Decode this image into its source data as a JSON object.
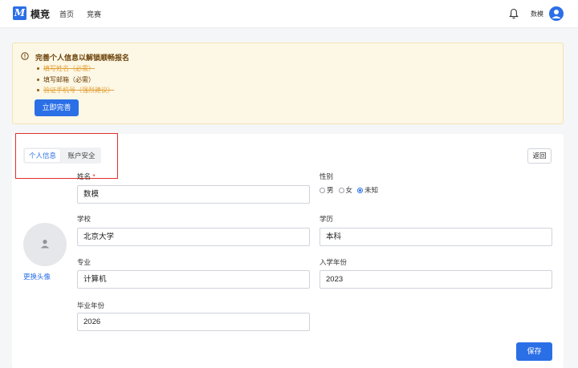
{
  "app": {
    "logo_letter": "M",
    "name": "模竞"
  },
  "nav": {
    "home": "首页",
    "competition": "竞赛"
  },
  "user": {
    "name": "数模"
  },
  "alert": {
    "title": "完善个人信息以解锁顺畅报名",
    "items": [
      {
        "text": "填写姓名（必需）",
        "done": true
      },
      {
        "text": "填写邮箱（必需）",
        "done": false
      },
      {
        "text": "验证手机号（强烈建议）",
        "done": true
      }
    ],
    "button": "立即完善"
  },
  "tabs": {
    "profile": "个人信息",
    "security": "账户安全",
    "active": "profile"
  },
  "back_button": "返回",
  "avatar": {
    "change_label": "更换头像"
  },
  "form": {
    "name": {
      "label": "姓名",
      "required_mark": "*",
      "value": "数模"
    },
    "gender": {
      "label": "性别",
      "options": [
        "男",
        "女",
        "未知"
      ],
      "selected": "未知"
    },
    "school": {
      "label": "学校",
      "value": "北京大学"
    },
    "education": {
      "label": "学历",
      "value": "本科"
    },
    "major": {
      "label": "专业",
      "value": "计算机"
    },
    "enrollment_year": {
      "label": "入学年份",
      "value": "2023"
    },
    "graduation_year": {
      "label": "毕业年份",
      "value": "2026"
    }
  },
  "save_button": "保存",
  "colors": {
    "primary": "#2b6fe6",
    "alert_bg": "#fdf7e5",
    "highlight": "#e0302b"
  }
}
